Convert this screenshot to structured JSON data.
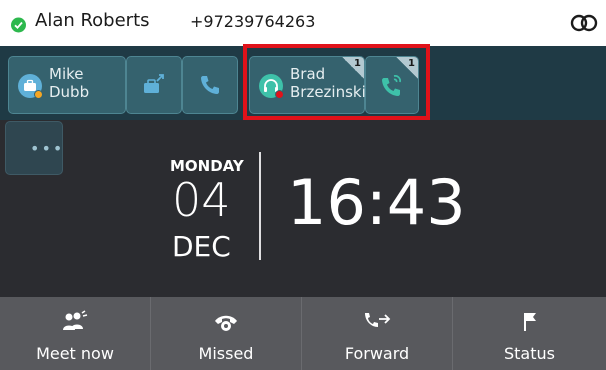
{
  "topbar": {
    "user_name": "Alan Roberts",
    "user_number": "+97239764263",
    "presence_color": "#2db84d"
  },
  "linekeys": [
    {
      "type": "contact",
      "label_line1": "Mike",
      "label_line2": "Dubb",
      "icon": "briefcase-user-icon",
      "status_color": "#f5a623"
    },
    {
      "type": "icon",
      "icon": "briefcase-forward-icon"
    },
    {
      "type": "icon",
      "icon": "phone-icon"
    },
    {
      "type": "contact",
      "label_line1": "Brad",
      "label_line2": "Brzezinski",
      "icon": "headset-user-icon",
      "status_color": "#e0121a",
      "badge": "1"
    },
    {
      "type": "icon",
      "icon": "phone-active-icon",
      "badge": "1"
    }
  ],
  "clock": {
    "day": "MONDAY",
    "date": "04",
    "month": "DEC",
    "time": "16:43"
  },
  "softkeys": [
    {
      "label": "Meet now",
      "icon": "meet-now-icon"
    },
    {
      "label": "Missed",
      "icon": "missed-call-icon"
    },
    {
      "label": "Forward",
      "icon": "forward-icon"
    },
    {
      "label": "Status",
      "icon": "flag-icon"
    }
  ],
  "colors": {
    "accent_teal": "#35626e",
    "highlight_red": "#e0121a",
    "softkey_bg": "#58595d"
  }
}
